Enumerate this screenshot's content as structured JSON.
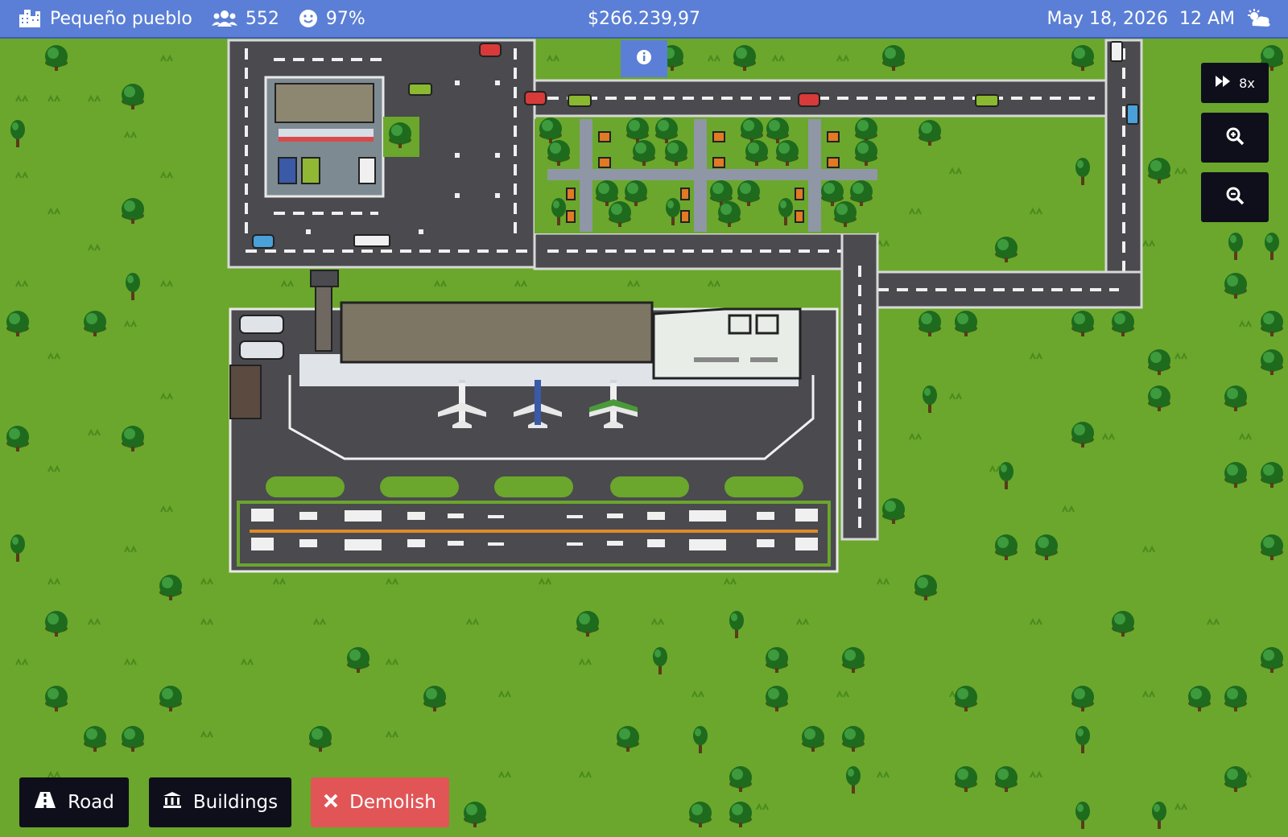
{
  "hud": {
    "city_name": "Pequeño pueblo",
    "population": "552",
    "happiness": "97%",
    "money": "$266.239,97",
    "date": "May 18, 2026",
    "time": "12 AM",
    "weather_icon": "partly-cloudy-icon"
  },
  "controls": {
    "speed_label": "8x",
    "zoom_in_icon": "zoom-in-icon",
    "zoom_out_icon": "zoom-out-icon",
    "info_icon": "info-icon"
  },
  "toolbar": {
    "road_label": "Road",
    "buildings_label": "Buildings",
    "demolish_label": "Demolish"
  },
  "colors": {
    "grass": "#6aa72c",
    "hud_bar": "#5b7fd6",
    "button_dark": "#0f0f1c",
    "demolish_red": "#e15557",
    "asphalt": "#4a4a4f"
  }
}
